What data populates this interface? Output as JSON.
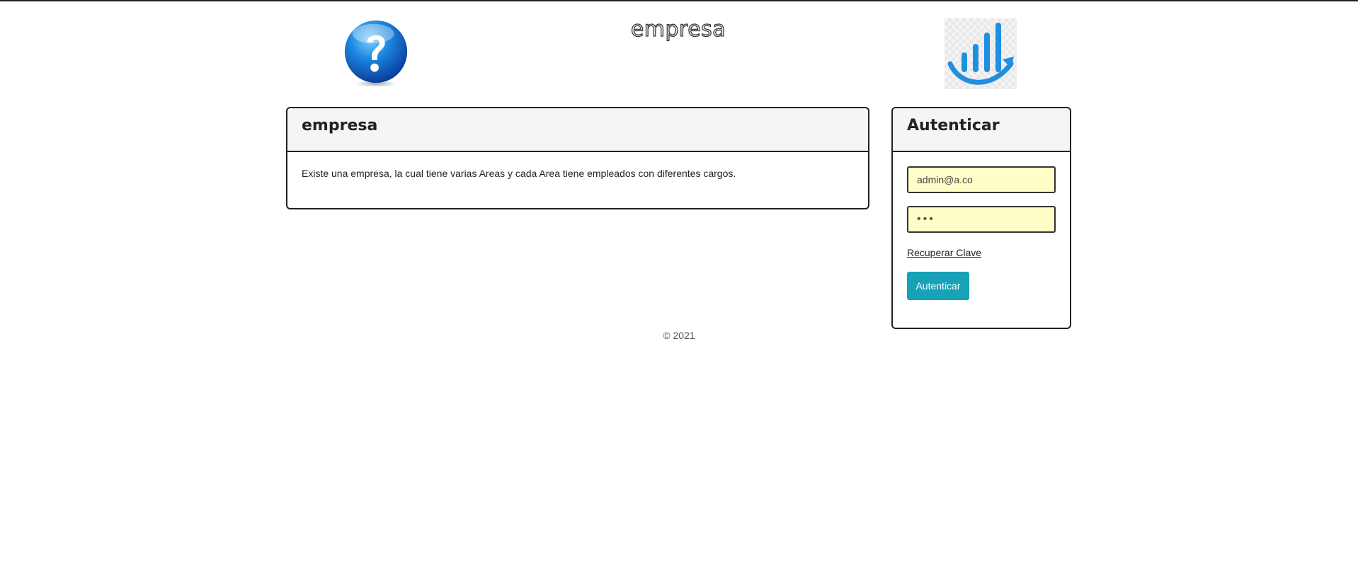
{
  "header": {
    "site_title": "empresa",
    "help_icon": "question-mark-icon",
    "brand_icon": "growth-chart-logo"
  },
  "main_panel": {
    "heading": "empresa",
    "description": "Existe una empresa, la cual tiene varias Areas y cada Area tiene empleados con diferentes cargos."
  },
  "login_panel": {
    "heading": "Autenticar",
    "email_value": "admin@a.co",
    "password_value": "•••",
    "recover_link": "Recuperar Clave",
    "submit_label": "Autenticar"
  },
  "footer": {
    "copyright": "© 2021"
  },
  "colors": {
    "button": "#17a2b8",
    "input_bg": "#fffdc8",
    "logo_blue": "#1f8fe0"
  }
}
